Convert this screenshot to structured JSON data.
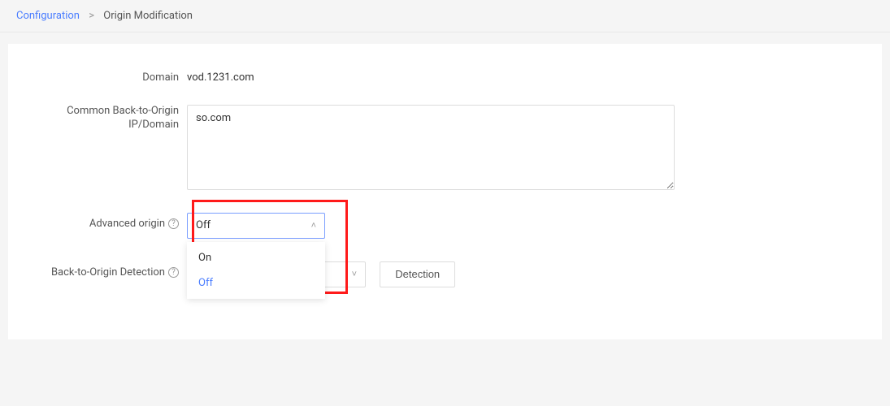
{
  "breadcrumb": {
    "parent": "Configuration",
    "separator": ">",
    "current": "Origin Modification"
  },
  "form": {
    "domain_label": "Domain",
    "domain_value": "vod.1231.com",
    "common_origin_label": "Common Back-to-Origin IP/Domain",
    "common_origin_value": "so.com",
    "advanced_label": "Advanced origin",
    "advanced_select": {
      "value": "Off",
      "options": [
        "On",
        "Off"
      ]
    },
    "detection_label": "Back-to-Origin Detection",
    "detection_select_value": "",
    "detection_button": "Detection"
  },
  "icons": {
    "help": "?",
    "chevron_up": "˄",
    "chevron_down": "˅"
  }
}
